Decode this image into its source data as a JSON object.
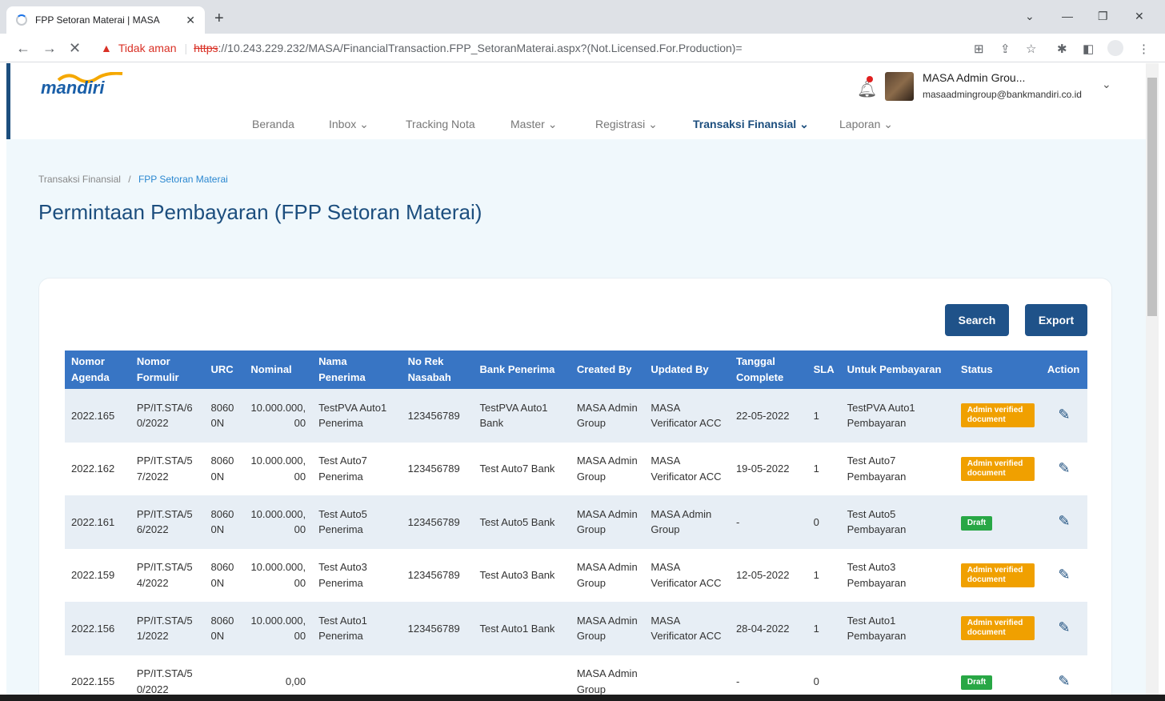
{
  "browser": {
    "tab_title": "FPP Setoran Materai | MASA",
    "tab_close": "✕",
    "new_tab": "+",
    "insecure_label": "Tidak aman",
    "url_scheme": "https",
    "url_rest": "://10.243.229.232/MASA/FinancialTransaction.FPP_SetoranMaterai.aspx?(Not.Licensed.For.Production)="
  },
  "app": {
    "logo_text": "mandiri",
    "user_name": "MASA Admin Grou...",
    "user_email": "masaadmingroup@bankmandiri.co.id"
  },
  "menu": [
    {
      "label": "Beranda",
      "chevron": ""
    },
    {
      "label": "Inbox",
      "chevron": "⌄"
    },
    {
      "label": "Tracking Nota",
      "chevron": ""
    },
    {
      "label": "Master",
      "chevron": "⌄"
    },
    {
      "label": "Registrasi",
      "chevron": "⌄"
    },
    {
      "label": "Transaksi Finansial",
      "chevron": "⌄"
    },
    {
      "label": "Laporan",
      "chevron": "⌄"
    }
  ],
  "breadcrumb": {
    "parent": "Transaksi Finansial",
    "separator": "/",
    "current": "FPP Setoran Materai"
  },
  "page_title": "Permintaan Pembayaran (FPP Setoran Materai)",
  "buttons": {
    "search": "Search",
    "export": "Export"
  },
  "table": {
    "headers": [
      "Nomor Agenda",
      "Nomor Formulir",
      "URC",
      "Nominal",
      "Nama Penerima",
      "No Rek Nasabah",
      "Bank Penerima",
      "Created By",
      "Updated By",
      "Tanggal Complete",
      "SLA",
      "Untuk Pembayaran",
      "Status",
      "Action"
    ],
    "rows": [
      {
        "agenda": "2022.165",
        "formulir": "PP/IT.STA/60/2022",
        "urc": "80600N",
        "nominal": "10.000.000,00",
        "penerima": "TestPVA Auto1 Penerima",
        "rek": "123456789",
        "bank": "TestPVA Auto1 Bank",
        "created": "MASA Admin Group",
        "updated": "MASA Verificator ACC",
        "tanggal": "22-05-2022",
        "sla": "1",
        "untuk": "TestPVA Auto1 Pembayaran",
        "status": "Admin verified document"
      },
      {
        "agenda": "2022.162",
        "formulir": "PP/IT.STA/57/2022",
        "urc": "80600N",
        "nominal": "10.000.000,00",
        "penerima": "Test Auto7 Penerima",
        "rek": "123456789",
        "bank": "Test Auto7 Bank",
        "created": "MASA Admin Group",
        "updated": "MASA Verificator ACC",
        "tanggal": "19-05-2022",
        "sla": "1",
        "untuk": "Test Auto7 Pembayaran",
        "status": "Admin verified document"
      },
      {
        "agenda": "2022.161",
        "formulir": "PP/IT.STA/56/2022",
        "urc": "80600N",
        "nominal": "10.000.000,00",
        "penerima": "Test Auto5 Penerima",
        "rek": "123456789",
        "bank": "Test Auto5 Bank",
        "created": "MASA Admin Group",
        "updated": "MASA Admin Group",
        "tanggal": "-",
        "sla": "0",
        "untuk": "Test Auto5 Pembayaran",
        "status": "Draft"
      },
      {
        "agenda": "2022.159",
        "formulir": "PP/IT.STA/54/2022",
        "urc": "80600N",
        "nominal": "10.000.000,00",
        "penerima": "Test Auto3 Penerima",
        "rek": "123456789",
        "bank": "Test Auto3 Bank",
        "created": "MASA Admin Group",
        "updated": "MASA Verificator ACC",
        "tanggal": "12-05-2022",
        "sla": "1",
        "untuk": "Test Auto3 Pembayaran",
        "status": "Admin verified document"
      },
      {
        "agenda": "2022.156",
        "formulir": "PP/IT.STA/51/2022",
        "urc": "80600N",
        "nominal": "10.000.000,00",
        "penerima": "Test Auto1 Penerima",
        "rek": "123456789",
        "bank": "Test Auto1 Bank",
        "created": "MASA Admin Group",
        "updated": "MASA Verificator ACC",
        "tanggal": "28-04-2022",
        "sla": "1",
        "untuk": "Test Auto1 Pembayaran",
        "status": "Admin verified document"
      },
      {
        "agenda": "2022.155",
        "formulir": "PP/IT.STA/50/2022",
        "urc": "",
        "nominal": "0,00",
        "penerima": "",
        "rek": "",
        "bank": "",
        "created": "MASA Admin Group",
        "updated": "",
        "tanggal": "-",
        "sla": "0",
        "untuk": "",
        "status": "Draft"
      }
    ]
  },
  "colors": {
    "primary": "#1c4e7e",
    "table_header": "#3875c4",
    "badge_orange": "#f0a000",
    "badge_green": "#28a745",
    "insecure": "#d93025"
  },
  "icons": {
    "edit": "edit-icon",
    "bell": "bell-icon",
    "warning": "warning-icon"
  }
}
